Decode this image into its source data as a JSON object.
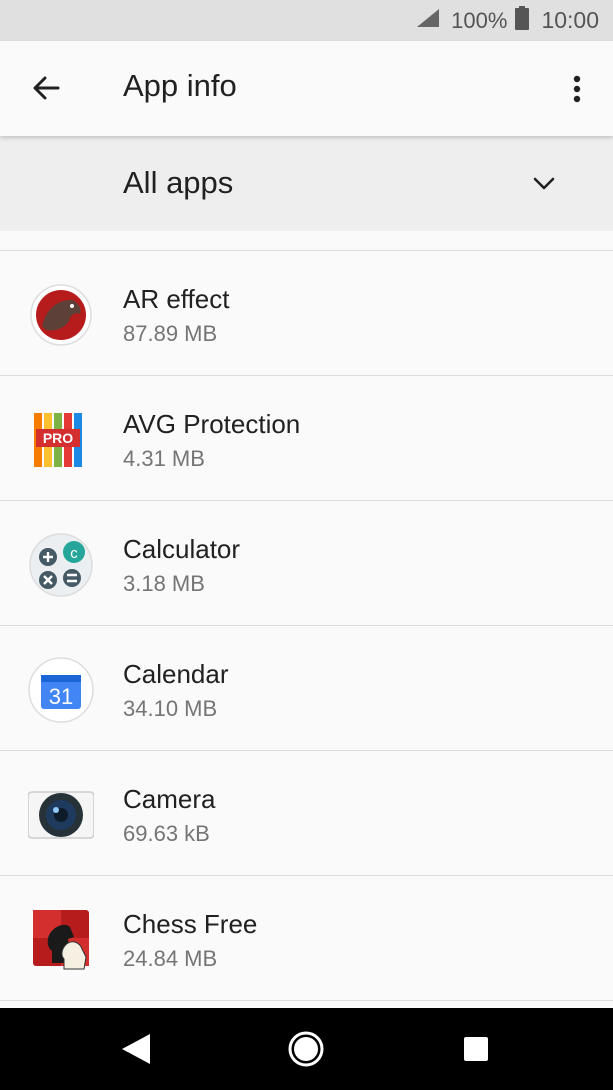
{
  "status": {
    "battery": "100%",
    "time": "10:00"
  },
  "header": {
    "title": "App info"
  },
  "filter": {
    "label": "All apps"
  },
  "apps": [
    {
      "name": "AR effect",
      "size": "87.89 MB",
      "icon": "ar-effect-icon"
    },
    {
      "name": "AVG Protection",
      "size": "4.31 MB",
      "icon": "avg-protection-icon"
    },
    {
      "name": "Calculator",
      "size": "3.18 MB",
      "icon": "calculator-icon"
    },
    {
      "name": "Calendar",
      "size": "34.10 MB",
      "icon": "calendar-icon"
    },
    {
      "name": "Camera",
      "size": "69.63 kB",
      "icon": "camera-icon"
    },
    {
      "name": "Chess Free",
      "size": "24.84 MB",
      "icon": "chess-free-icon"
    }
  ],
  "calendar_icon_text": "31",
  "avg_icon_text": "PRO",
  "calculator_icon_text": "c"
}
